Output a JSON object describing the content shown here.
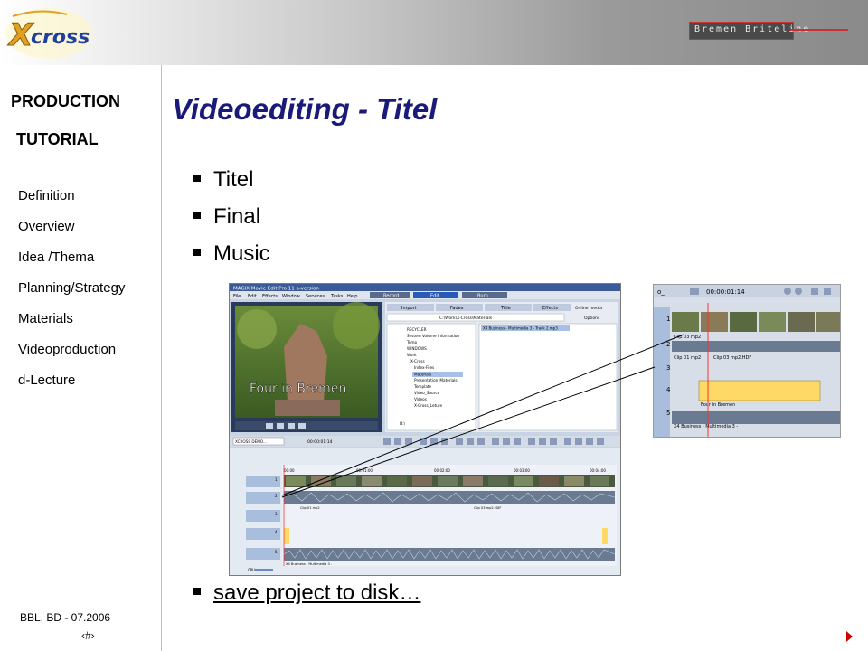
{
  "header": {
    "logo_text": "X-cross",
    "brand_text": "Bremen Briteline"
  },
  "sidebar": {
    "title_line1": "PRODUCTION",
    "title_line2": "TUTORIAL",
    "items": [
      {
        "label": "Definition"
      },
      {
        "label": "Overview"
      },
      {
        "label": "Idea /Thema"
      },
      {
        "label": "Planning/Strategy"
      },
      {
        "label": "Materials"
      },
      {
        "label": "Videoproduction"
      },
      {
        "label": "d-Lecture"
      }
    ]
  },
  "main": {
    "title": "Videoediting - Titel",
    "bullets": [
      {
        "text": "Titel"
      },
      {
        "text": "Final"
      },
      {
        "text": "Music"
      }
    ],
    "save_text": "save project to disk…"
  },
  "footer": {
    "author_date": "BBL, BD - 07.2006",
    "page_number": "‹#›"
  },
  "screenshot": {
    "app_title": "MAGIX Movie Edit Pro 11 a-version",
    "menu": [
      "File",
      "Edit",
      "Effects",
      "Window",
      "Services",
      "Tasks",
      "Help"
    ],
    "modes": [
      "Record",
      "Edit",
      "Burn"
    ],
    "tabs": [
      "Import",
      "Fades",
      "Title",
      "Effects"
    ],
    "online_media": "Online media",
    "options": "Options",
    "path": "C:\\Work\\X-Cross\\Materials",
    "media_file": "X4 Business - Multimedia 3 - Track 2.mp3",
    "overlay_text": "Four in Bremen",
    "folders": [
      "RECYCLER",
      "System Volume Information",
      "Temp",
      "WINDOWS",
      "Work",
      "X-Cross",
      "Index-Files",
      "Materials",
      "Presentation_Materials",
      "Template",
      "Video_Source",
      "Videos",
      "X-Cross_Leture",
      "D:\\"
    ],
    "project_name": "XCROSS DEMO...",
    "timecode": "00:00:01:14",
    "ruler": [
      "00:00",
      "00:01:00",
      "00:02:00",
      "00:03:00",
      "00:04:00"
    ],
    "clip_labels": [
      "Clip 01 mp2",
      "Clip 03 mp2.HDF"
    ],
    "audio_label": "X4 Business - Multimedia 3 -",
    "track_numbers": [
      "1",
      "2",
      "3",
      "4",
      "5"
    ],
    "cpu_label": "CPU"
  },
  "zoom": {
    "timecode": "00:00:01:14",
    "title_clip": "Four in Bremen",
    "clip_labels": [
      "Clip 03 mp2",
      "Clip 01 mp2",
      "Clip 03 mp2.HDF"
    ],
    "audio_label": "X4 Business - Multimedia 3 -"
  },
  "colors": {
    "title": "#1a1a7a",
    "arrow": "#d00000",
    "timeline_marker": "#ff3030",
    "title_clip": "#ffd966",
    "app_chrome": "#4a66a0"
  }
}
